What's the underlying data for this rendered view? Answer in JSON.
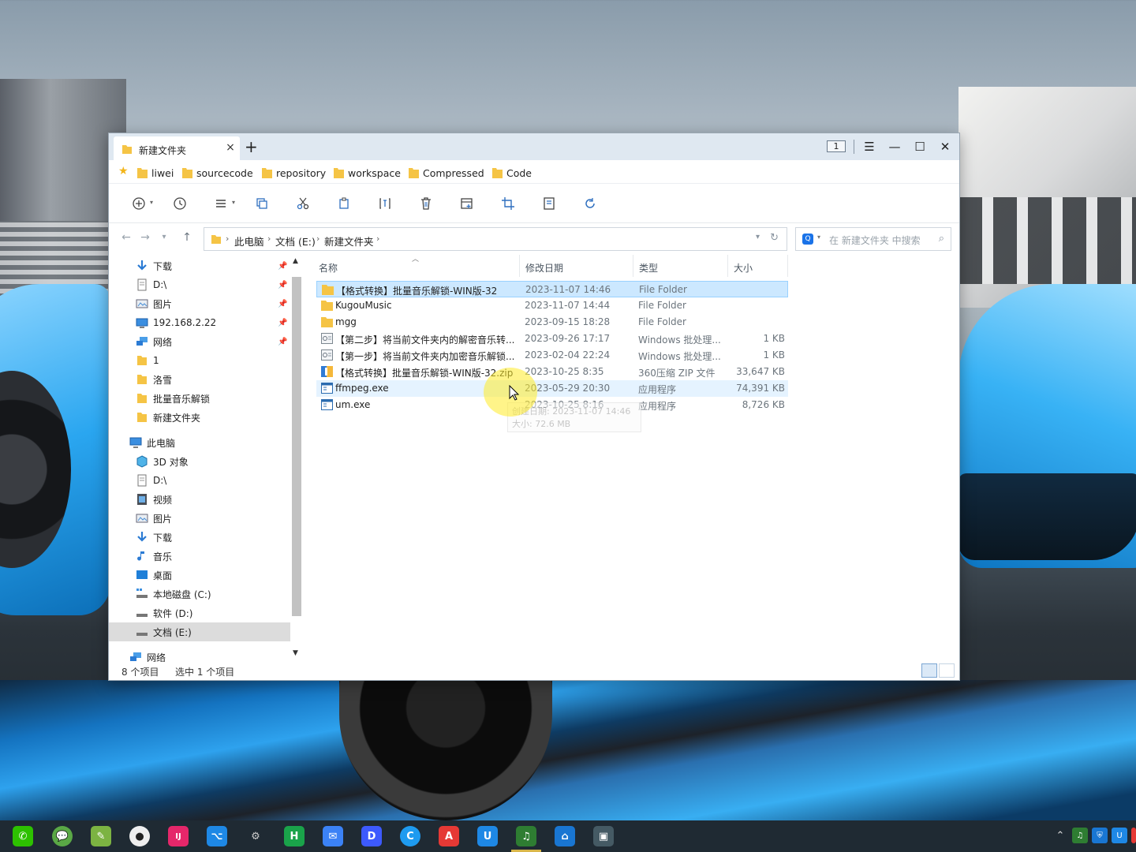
{
  "window": {
    "tab_title": "新建文件夹",
    "tab_close": "×",
    "new_tab": "+",
    "window_count": "1",
    "controls": {
      "menu": "☰",
      "minimize": "—",
      "maximize": "☐",
      "close": "✕"
    }
  },
  "favorites": [
    "liwei",
    "sourcecode",
    "repository",
    "workspace",
    "Compressed",
    "Code"
  ],
  "toolbar_icons": [
    "new-icon",
    "history-icon",
    "view-mode-icon",
    "copy-icon",
    "cut-icon",
    "paste-icon",
    "rename-icon",
    "delete-icon",
    "properties-icon",
    "crop-icon",
    "notepad-icon",
    "refresh-icon"
  ],
  "address": {
    "crumbs": [
      "此电脑",
      "文档 (E:)",
      "新建文件夹"
    ],
    "search_placeholder": "在 新建文件夹 中搜索"
  },
  "nav_pane": {
    "quick_access": [
      {
        "label": "下载",
        "icon": "download-icon",
        "pinned": true
      },
      {
        "label": "D:\\",
        "icon": "drive-icon",
        "pinned": true
      },
      {
        "label": "图片",
        "icon": "pictures-icon",
        "pinned": true
      },
      {
        "label": "192.168.2.22",
        "icon": "network-drive-icon",
        "pinned": true
      },
      {
        "label": "网络",
        "icon": "network-icon",
        "pinned": true
      },
      {
        "label": "1",
        "icon": "folder-icon",
        "pinned": false
      },
      {
        "label": "洛雪",
        "icon": "folder-icon",
        "pinned": false
      },
      {
        "label": "批量音乐解锁",
        "icon": "folder-icon",
        "pinned": false
      },
      {
        "label": "新建文件夹",
        "icon": "folder-icon",
        "pinned": false
      }
    ],
    "this_pc": "此电脑",
    "pc_items": [
      {
        "label": "3D 对象",
        "icon": "3d-objects-icon"
      },
      {
        "label": "D:\\",
        "icon": "drive-icon"
      },
      {
        "label": "视频",
        "icon": "videos-icon"
      },
      {
        "label": "图片",
        "icon": "pictures-icon"
      },
      {
        "label": "下载",
        "icon": "download-icon"
      },
      {
        "label": "音乐",
        "icon": "music-icon"
      },
      {
        "label": "桌面",
        "icon": "desktop-icon"
      },
      {
        "label": "本地磁盘 (C:)",
        "icon": "local-disk-icon"
      },
      {
        "label": "软件 (D:)",
        "icon": "disk-icon"
      },
      {
        "label": "文档 (E:)",
        "icon": "disk-icon",
        "selected": true
      }
    ],
    "network": "网络"
  },
  "columns": {
    "name": "名称",
    "date": "修改日期",
    "type": "类型",
    "size": "大小"
  },
  "files": [
    {
      "name": "【格式转换】批量音乐解锁-WIN版-32",
      "date": "2023-11-07 14:46",
      "type": "File Folder",
      "size": "",
      "icon": "folder",
      "state": "selected"
    },
    {
      "name": "KugouMusic",
      "date": "2023-11-07 14:44",
      "type": "File Folder",
      "size": "",
      "icon": "folder",
      "state": ""
    },
    {
      "name": "mgg",
      "date": "2023-09-15 18:28",
      "type": "File Folder",
      "size": "",
      "icon": "folder",
      "state": ""
    },
    {
      "name": "【第二步】将当前文件夹内的解密音乐转...",
      "date": "2023-09-26 17:17",
      "type": "Windows 批处理...",
      "size": "1 KB",
      "icon": "batch",
      "state": ""
    },
    {
      "name": "【第一步】将当前文件夹内加密音乐解锁...",
      "date": "2023-02-04 22:24",
      "type": "Windows 批处理...",
      "size": "1 KB",
      "icon": "batch",
      "state": ""
    },
    {
      "name": "【格式转换】批量音乐解锁-WIN版-32.zip",
      "date": "2023-10-25 8:35",
      "type": "360压缩 ZIP 文件",
      "size": "33,647 KB",
      "icon": "zip",
      "state": ""
    },
    {
      "name": "ffmpeg.exe",
      "date": "2023-05-29 20:30",
      "type": "应用程序",
      "size": "74,391 KB",
      "icon": "exe",
      "state": "hover"
    },
    {
      "name": "um.exe",
      "date": "2023-10-25 8:16",
      "type": "应用程序",
      "size": "8,726 KB",
      "icon": "exe",
      "state": ""
    }
  ],
  "tooltip": {
    "line1": "创建日期: 2023-11-07 14:46",
    "line2": "大小: 72.6 MB"
  },
  "status": {
    "count": "8 个项目",
    "selected": "选中 1 个项目"
  },
  "taskbar": {
    "apps": [
      "wechat-icon",
      "chat-bubble-icon",
      "notepad-plus-icon",
      "qq-icon",
      "intellij-icon",
      "vscode-icon",
      "settings-gear-icon",
      "hbuilder-icon",
      "feishu-icon",
      "dingtalk-icon",
      "browser-c-icon",
      "pdf-editor-icon",
      "u-tools-icon",
      "music-unlock-icon",
      "remote-desktop-icon",
      "screen-capture-icon"
    ],
    "app_glyphs": [
      "✆",
      "💬",
      "✎",
      "●",
      "IJ",
      "⌥",
      "⚙",
      "H",
      "✉",
      "D",
      "C",
      "A",
      "U",
      "♫",
      "⌂",
      "▣"
    ],
    "active_index": 13,
    "tray_chevron": "⌃",
    "tray_icons": [
      "music-tray-icon",
      "security-tray-icon",
      "u-tray-icon",
      "pdf-tray-icon",
      "battery-tray-icon"
    ]
  },
  "colors": {
    "selected_row": "#cce8ff",
    "hover_row": "#e5f3ff",
    "folder": "#f5c445",
    "accent": "#1a73e8"
  }
}
